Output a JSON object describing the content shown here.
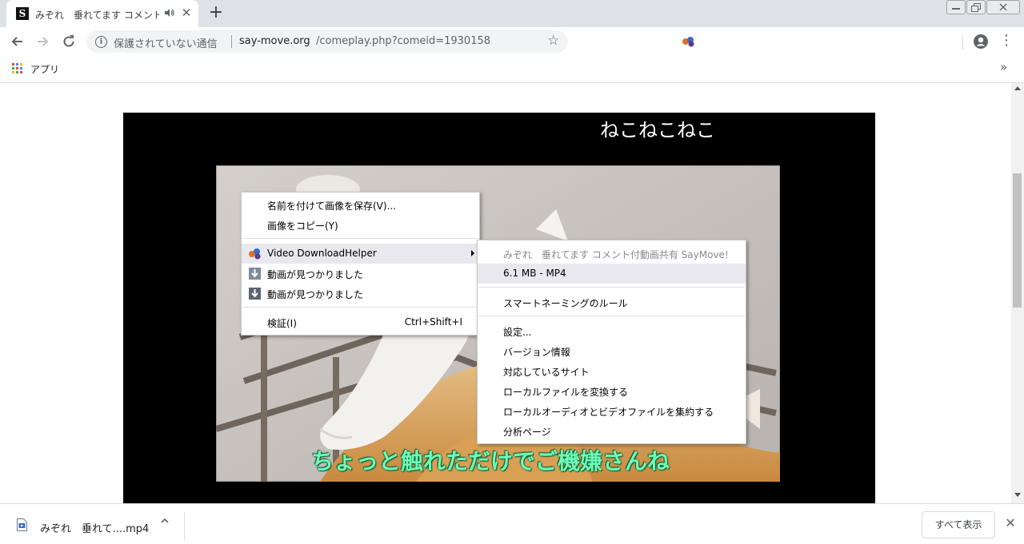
{
  "browser": {
    "tab": {
      "favicon_letter": "S",
      "title": "みぞれ　垂れてます コメント付動画共有 SayMove!",
      "close_glyph": "✕"
    },
    "new_tab_glyph": "+",
    "omnibox": {
      "security_text": "保護されていない通信",
      "url_host": "say-move.org",
      "url_path": "/comeplay.php?comeid=1930158"
    },
    "bookmarks": {
      "apps_label": "アプリ",
      "overflow_glyph": "»"
    }
  },
  "page": {
    "comment_text": "ねこねこねこ",
    "subtitle": "ちょっと触れただけでご機嫌さんね"
  },
  "context_menu": {
    "items": [
      {
        "label": "名前を付けて画像を保存(V)..."
      },
      {
        "label": "画像をコピー(Y)"
      },
      {
        "label": "Video DownloadHelper",
        "icon": "video-downloadhelper-icon"
      },
      {
        "label": "動画が見つかりました",
        "icon": "download-arrow-icon"
      },
      {
        "label": "動画が見つかりました",
        "icon": "download-arrow-icon"
      },
      {
        "label": "検証(I)",
        "shortcut": "Ctrl+Shift+I"
      }
    ]
  },
  "sub_menu": {
    "items": [
      {
        "label": "みぞれ　垂れてます コメント付動画共有 SayMove!",
        "disabled": true
      },
      {
        "label": "6.1 MB - MP4",
        "highlighted": true
      },
      {
        "label": "スマートネーミングのルール"
      },
      {
        "label": "設定..."
      },
      {
        "label": "バージョン情報"
      },
      {
        "label": "対応しているサイト"
      },
      {
        "label": "ローカルファイルを変換する"
      },
      {
        "label": "ローカルオーディオとビデオファイルを集約する"
      },
      {
        "label": "分析ページ"
      }
    ]
  },
  "download_shelf": {
    "file_name": "みぞれ　垂れて....mp4",
    "show_all_label": "すべて表示",
    "close_glyph": "✕"
  },
  "colors": {
    "subtitle": "#6ef9b8",
    "tabstrip": "#dee1e6",
    "menu_highlight": "#e8e8ee"
  }
}
